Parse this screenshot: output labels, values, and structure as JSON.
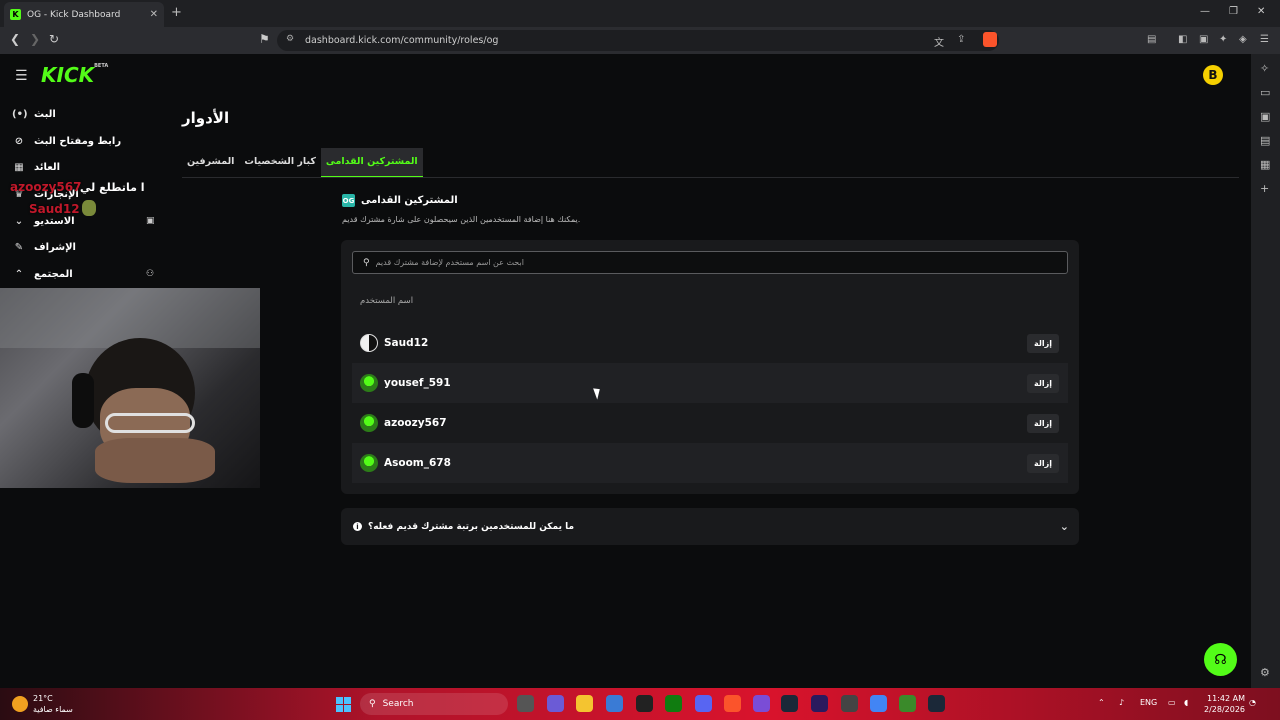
{
  "browser": {
    "tab_title": "OG - Kick Dashboard",
    "favicon": "K",
    "new_tab": "+",
    "url": "dashboard.kick.com/community/roles/og"
  },
  "app": {
    "logo": "KICK",
    "logo_tag": "BETA",
    "user_avatar": "B",
    "sidebar": {
      "items": [
        {
          "label": "البث",
          "icon": "live-icon",
          "glyph": "(•)"
        },
        {
          "label": "رابط ومفتاح البث",
          "icon": "link-icon",
          "glyph": "⊘"
        },
        {
          "label": "العائد",
          "icon": "revenue-icon",
          "glyph": "▦"
        },
        {
          "label": "الإنجازات",
          "icon": "trophy-icon",
          "glyph": "♛"
        },
        {
          "label": "الاستديو",
          "icon": "chevron-down-icon",
          "glyph": "⌄"
        },
        {
          "label": "الإشراف",
          "icon": "wrench-icon",
          "glyph": "✎"
        },
        {
          "label": "المجتمع",
          "icon": "chevron-up-icon",
          "glyph": "⌃"
        }
      ]
    },
    "overlay": {
      "name1": "azoozy567",
      "text1": "ا ماتطلع لي",
      "name2": "Saud12"
    },
    "page_title": "الأدوار",
    "tabs": [
      {
        "label": "المشرفين",
        "active": false
      },
      {
        "label": "كبار الشخصيات",
        "active": false
      },
      {
        "label": "المشتركين القدامى",
        "active": true
      }
    ],
    "section": {
      "badge": "OG",
      "title": "المشتركين القدامى",
      "subtitle": "يمكنك هنا إضافة المستخدمين الذين سيحصلون على شارة مشترك قديم."
    },
    "search": {
      "placeholder": "ابحث عن اسم مستخدم لإضافة مشترك قديم"
    },
    "column_header": "اسم المستخدم",
    "users": [
      {
        "name": "Saud12",
        "action": "إزالة"
      },
      {
        "name": "yousef_591",
        "action": "إزالة"
      },
      {
        "name": "azoozy567",
        "action": "إزالة"
      },
      {
        "name": "Asoom_678",
        "action": "إزالة"
      }
    ],
    "faq": "ما يمكن للمستخدمين برتبة مشترك قديم فعله؟",
    "accent": "#53fc18"
  },
  "taskbar": {
    "temp": "21°C",
    "weather": "سماء صافية",
    "search": "Search",
    "lang": "ENG",
    "time": "11:42 AM",
    "date": "2/28/2026"
  }
}
